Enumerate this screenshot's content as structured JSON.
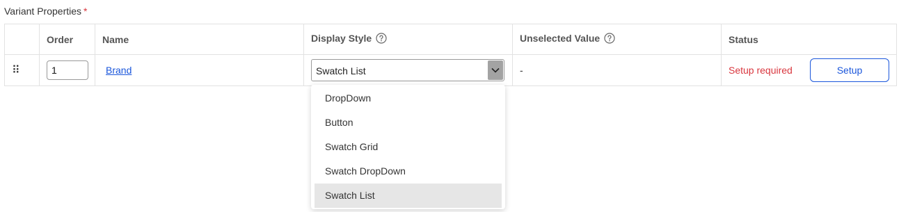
{
  "section": {
    "label": "Variant Properties",
    "required_mark": "*"
  },
  "table": {
    "headers": {
      "order": "Order",
      "name": "Name",
      "display_style": "Display Style",
      "unselected_value": "Unselected Value",
      "status": "Status"
    },
    "row": {
      "drag": "⠿",
      "order": "1",
      "name": "Brand",
      "display_style": "Swatch List",
      "unselected_value": "-",
      "status": "Setup required",
      "action_label": "Setup"
    }
  },
  "dropdown": {
    "options": [
      "DropDown",
      "Button",
      "Swatch Grid",
      "Swatch DropDown",
      "Swatch List"
    ],
    "selected": "Swatch List"
  },
  "colors": {
    "required": "#d9363e",
    "link": "#1a56db",
    "highlight": "#e6e6e6"
  }
}
